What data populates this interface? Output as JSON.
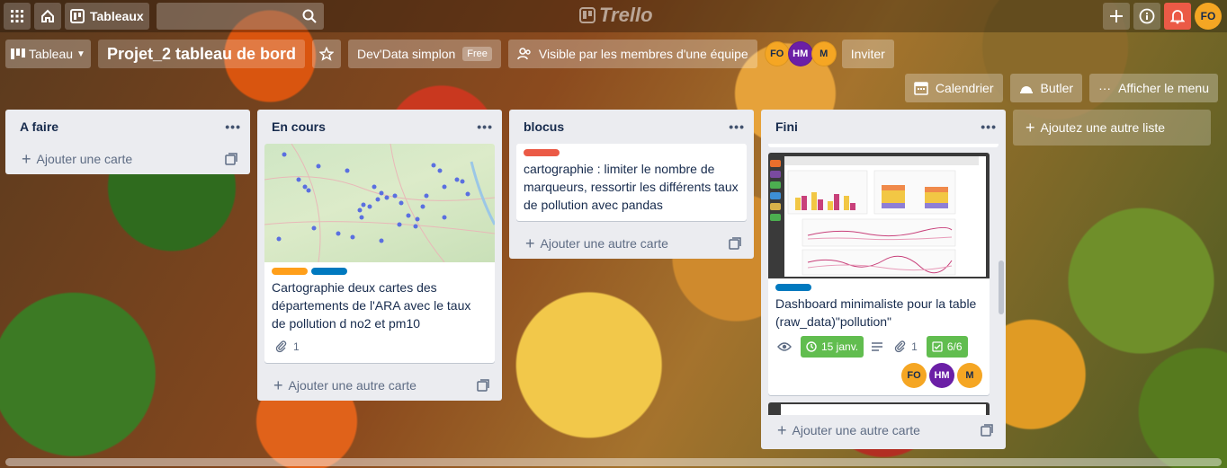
{
  "topbar": {
    "boards_label": "Tableaux",
    "logo_text": "Trello",
    "user_initials": "FO",
    "icons": [
      "apps-grid-icon",
      "home-icon",
      "board-icon",
      "search-icon",
      "plus-icon",
      "info-icon",
      "bell-icon"
    ]
  },
  "boardbar": {
    "view_label": "Tableau",
    "board_title": "Projet_2 tableau de bord",
    "workspace": "Dev'Data simplon",
    "workspace_badge": "Free",
    "visibility": "Visible par les membres d'une équipe",
    "members": [
      "FO",
      "HM",
      "M"
    ],
    "invite_label": "Inviter"
  },
  "secondbar": {
    "calendar_label": "Calendrier",
    "butler_label": "Butler",
    "menu_label": "Afficher le menu"
  },
  "lists": [
    {
      "title": "A faire",
      "add_label": "Ajouter une carte"
    },
    {
      "title": "En cours",
      "add_label": "Ajouter une autre carte",
      "card": {
        "labels": [
          "#ff9f1a",
          "#0079bf"
        ],
        "text": "Cartographie deux cartes des départements de l'ARA avec le taux de pollution d no2 et pm10",
        "attachments": "1"
      }
    },
    {
      "title": "blocus",
      "add_label": "Ajouter une autre carte",
      "card": {
        "labels": [
          "#eb5a46"
        ],
        "text": "cartographie : limiter le nombre de marqueurs, ressortir les différents taux de pollution avec pandas"
      }
    },
    {
      "title": "Fini",
      "add_label": "Ajouter une autre carte",
      "card": {
        "labels": [
          "#0079bf"
        ],
        "text": "Dashboard minimaliste pour la table (raw_data)\"pollution\"",
        "due": "15 janv.",
        "attachments": "1",
        "checklist": "6/6",
        "members": [
          "FO",
          "HM",
          "M"
        ]
      }
    }
  ],
  "add_list_label": "Ajoutez une autre liste",
  "colors": {
    "green_badge": "#61bd4f",
    "notification": "#eb5a46",
    "list_bg": "#ebecf0"
  }
}
